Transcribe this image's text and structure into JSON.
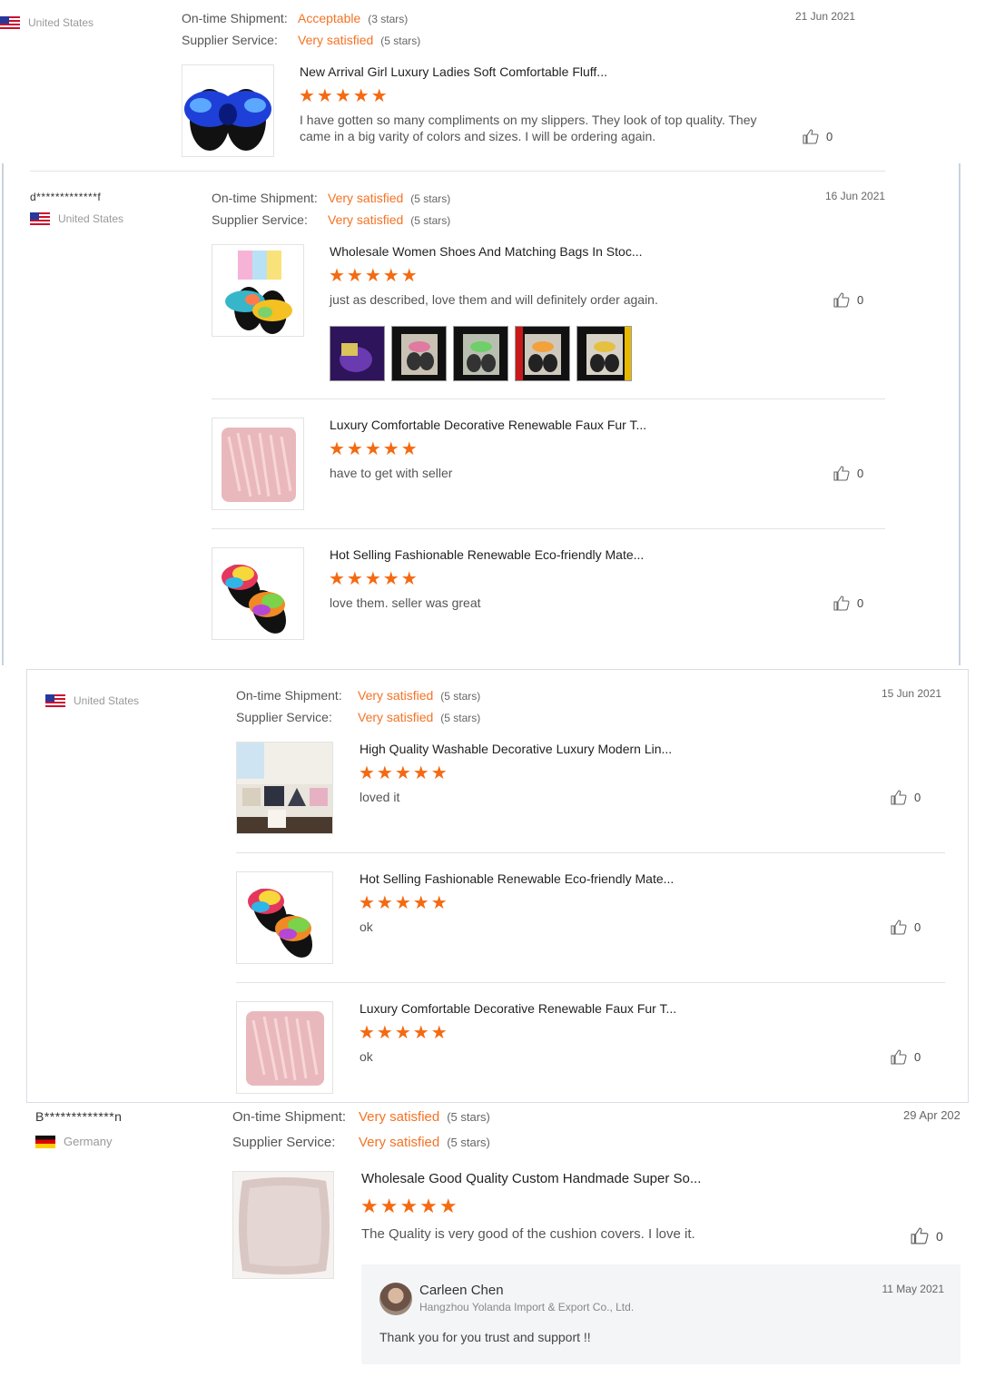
{
  "labels": {
    "ontime": "On-time Shipment:",
    "supplier": "Supplier Service:"
  },
  "star_glyphs": "★★★★★",
  "reviews": [
    {
      "user": "",
      "country": "United States",
      "date": "21 Jun 2021",
      "ontime": {
        "value": "Acceptable",
        "stars": "(3 stars)"
      },
      "supplier": {
        "value": "Very satisfied",
        "stars": "(5 stars)"
      },
      "items": [
        {
          "title": "New Arrival Girl Luxury Ladies Soft Comfortable Fluff...",
          "rating": 5,
          "comment": "I have gotten so many compliments on my slippers. They look of top quality. They came in a big varity of colors and sizes. I will be ordering again.",
          "likes": "0",
          "image": "blue-fur-slippers"
        }
      ]
    },
    {
      "user": "d*************f",
      "country": "United States",
      "date": "16 Jun 2021",
      "ontime": {
        "value": "Very satisfied",
        "stars": "(5 stars)"
      },
      "supplier": {
        "value": "Very satisfied",
        "stars": "(5 stars)"
      },
      "items": [
        {
          "title": "Wholesale Women Shoes And Matching Bags In Stoc...",
          "rating": 5,
          "comment": "just as described, love them and will definitely order again.",
          "likes": "0",
          "image": "rainbow-slippers-with-bag",
          "photos": 5
        },
        {
          "title": "Luxury Comfortable Decorative Renewable Faux Fur T...",
          "rating": 5,
          "comment": "have to get with seller",
          "likes": "0",
          "image": "pink-fur-pillow"
        },
        {
          "title": "Hot Selling Fashionable Renewable Eco-friendly Mate...",
          "rating": 5,
          "comment": "love them. seller was great",
          "likes": "0",
          "image": "rainbow-fur-slippers"
        }
      ]
    },
    {
      "user": "",
      "country": "United States",
      "date": "15 Jun 2021",
      "ontime": {
        "value": "Very satisfied",
        "stars": "(5 stars)"
      },
      "supplier": {
        "value": "Very satisfied",
        "stars": "(5 stars)"
      },
      "items": [
        {
          "title": "High Quality Washable Decorative Luxury Modern Lin...",
          "rating": 5,
          "comment": "loved it",
          "likes": "0",
          "image": "sofa-pillows"
        },
        {
          "title": "Hot Selling Fashionable Renewable Eco-friendly Mate...",
          "rating": 5,
          "comment": "ok",
          "likes": "0",
          "image": "rainbow-fur-slippers"
        },
        {
          "title": "Luxury Comfortable Decorative Renewable Faux Fur T...",
          "rating": 5,
          "comment": "ok",
          "likes": "0",
          "image": "pink-fur-pillow"
        }
      ]
    },
    {
      "user": "B*************n",
      "country": "Germany",
      "date": "29 Apr 202",
      "ontime": {
        "value": "Very satisfied",
        "stars": "(5 stars)"
      },
      "supplier": {
        "value": "Very satisfied",
        "stars": "(5 stars)"
      },
      "items": [
        {
          "title": "Wholesale Good Quality Custom Handmade Super So...",
          "rating": 5,
          "comment": "The Quality is very good of the cushion covers. I love it.",
          "likes": "0",
          "image": "beige-cushion"
        }
      ],
      "reply": {
        "name": "Carleen Chen",
        "company": "Hangzhou Yolanda Import & Export Co., Ltd.",
        "date": "11 May 2021",
        "text": "Thank you for you trust and support !!"
      }
    }
  ]
}
